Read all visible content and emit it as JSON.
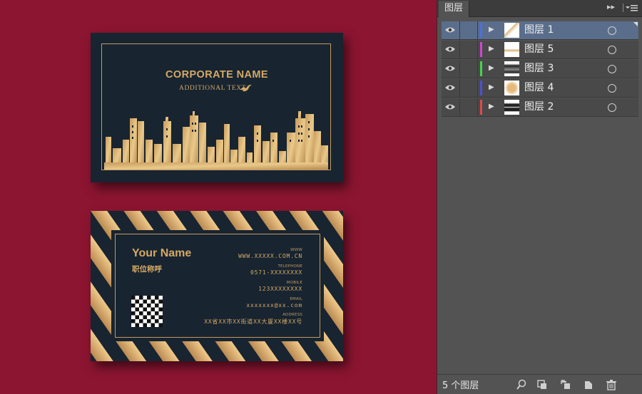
{
  "colors": {
    "background": "#8c1531",
    "card": "#182430",
    "gold": "#d4a965",
    "panel": "#535353",
    "selected_row": "#5a6e8c"
  },
  "front_card": {
    "corporate_name": "CORPORATE NAME",
    "additional_text": "ADDITIONAL TEXT",
    "logo_icon": "bird-icon",
    "illustration": "city-skyline"
  },
  "back_card": {
    "your_name": "Your Name",
    "job_title": "职位称呼",
    "www_label": "WWW",
    "www_value": "WWW.XXXXX.COM.CN",
    "telephone_label": "TELEPHONE",
    "telephone_value": "0571-XXXXXXXX",
    "mobile_label": "MOBILE",
    "mobile_value": "123XXXXXXXX",
    "email_label": "EMAIL",
    "email_value": "xxxxxxx@xx.com",
    "address_label": "ADDRESS",
    "address_value": "XX省XX市XX街道XX大厦XX楼XX号"
  },
  "layers_panel": {
    "tab_label": "图层",
    "layers": [
      {
        "name": "图层 1",
        "color": "#4d6fe0",
        "selected": true,
        "thumb": "card-front"
      },
      {
        "name": "图层 5",
        "color": "#d043d6",
        "selected": false,
        "thumb": "gold-light"
      },
      {
        "name": "图层 3",
        "color": "#44d44a",
        "selected": false,
        "thumb": "dark-gradient"
      },
      {
        "name": "图层 4",
        "color": "#4f4fd8",
        "selected": false,
        "thumb": "gold-swatch"
      },
      {
        "name": "图层 2",
        "color": "#e04848",
        "selected": false,
        "thumb": "dark-card"
      }
    ],
    "layer_count": "5 个图层",
    "bottom_icons": [
      "locate-object-icon",
      "make-clipping-mask-icon",
      "new-sublayer-icon",
      "new-layer-icon",
      "trash-icon"
    ]
  }
}
